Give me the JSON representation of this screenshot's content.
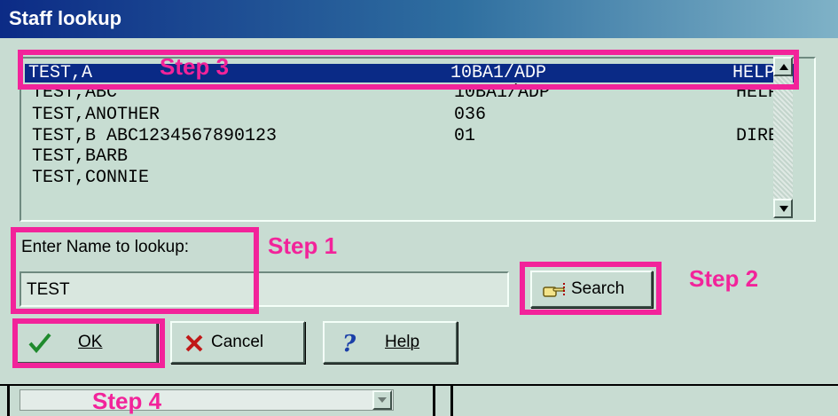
{
  "window": {
    "title": "Staff lookup"
  },
  "list": {
    "rows": [
      {
        "name": "TEST,A",
        "code": "10BA1/ADP",
        "extra": "HELP",
        "selected": true
      },
      {
        "name": "TEST,ABC",
        "code": "10BA1/ADP",
        "extra": "HELP",
        "selected": false
      },
      {
        "name": "TEST,ANOTHER",
        "code": "036",
        "extra": "",
        "selected": false
      },
      {
        "name": "TEST,B ABC1234567890123",
        "code": "01",
        "extra": "DIREC",
        "selected": false
      },
      {
        "name": "TEST,BARB",
        "code": "",
        "extra": "",
        "selected": false
      },
      {
        "name": "TEST,CONNIE",
        "code": "",
        "extra": "",
        "selected": false
      }
    ]
  },
  "lookup": {
    "label": "Enter Name to lookup:",
    "value": "TEST"
  },
  "buttons": {
    "search": "Search",
    "ok": "OK",
    "cancel": "Cancel",
    "help": "Help"
  },
  "annotations": {
    "step1": "Step 1",
    "step2": "Step 2",
    "step3": "Step 3",
    "step4": "Step 4"
  },
  "colors": {
    "accent": "#f2239a",
    "selection": "#0a2a86",
    "background": "#c8dcd2"
  }
}
